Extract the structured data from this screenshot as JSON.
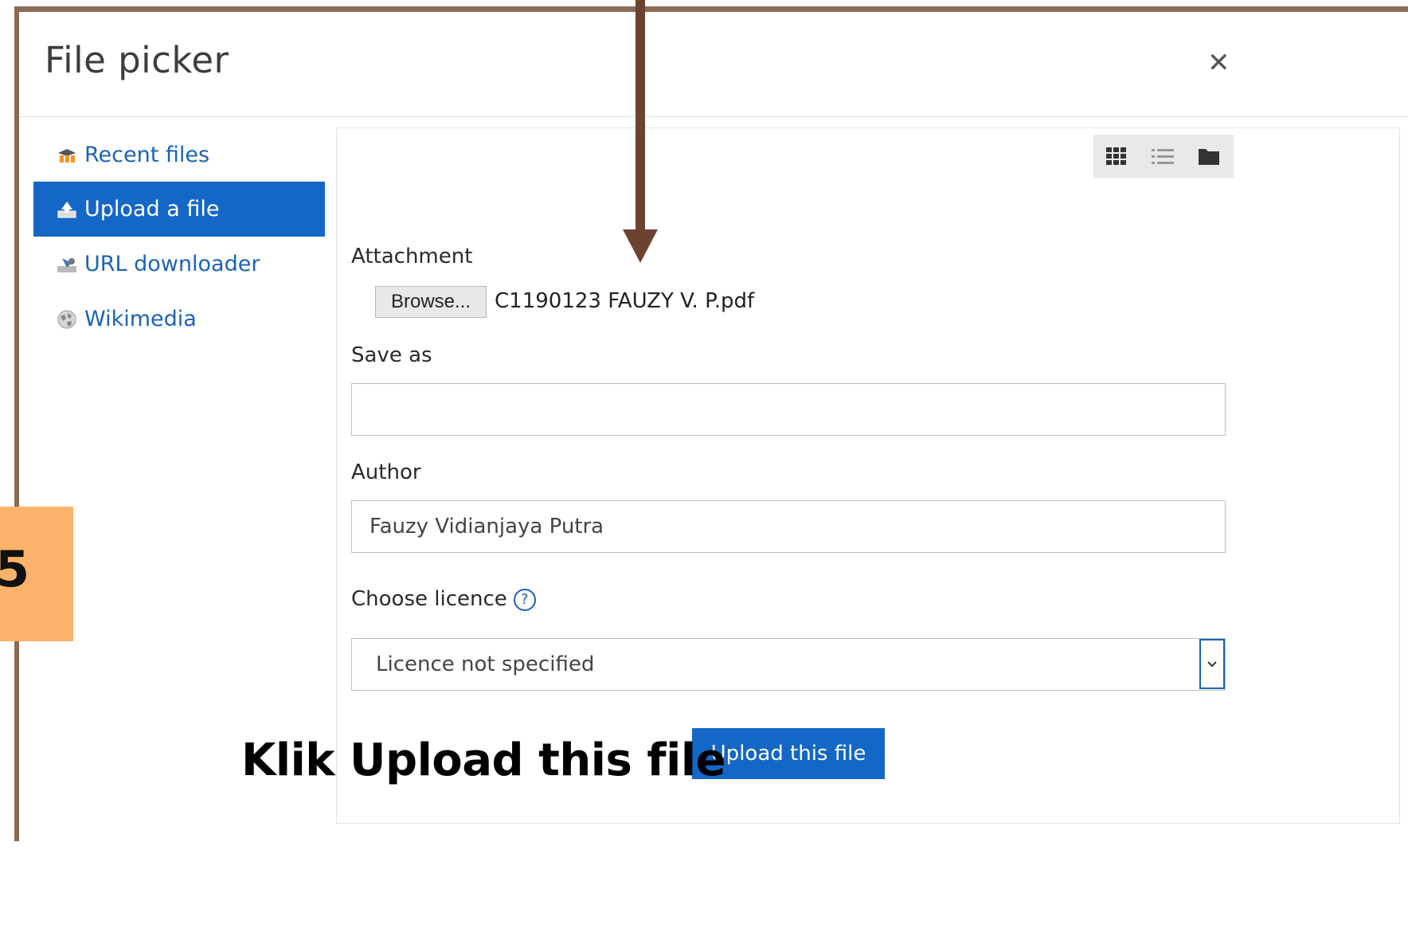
{
  "dialog": {
    "title": "File picker",
    "close_icon": "close-icon"
  },
  "sidebar": {
    "items": [
      {
        "label": "Recent files",
        "icon": "moodle-icon",
        "active": false
      },
      {
        "label": "Upload a file",
        "icon": "upload-icon",
        "active": true
      },
      {
        "label": "URL downloader",
        "icon": "url-download-icon",
        "active": false
      },
      {
        "label": "Wikimedia",
        "icon": "wikimedia-globe-icon",
        "active": false
      }
    ]
  },
  "toolbar": {
    "view_buttons": [
      "grid-view-icon",
      "list-view-icon",
      "folder-view-icon"
    ]
  },
  "form": {
    "attachment_label": "Attachment",
    "browse_label": "Browse...",
    "file_name": "C1190123 FAUZY V. P.pdf",
    "save_as_label": "Save as",
    "save_as_value": "",
    "author_label": "Author",
    "author_value": "Fauzy Vidianjaya Putra",
    "licence_label": "Choose licence",
    "licence_value": "Licence not specified",
    "upload_button": "Upload this file"
  },
  "annotation": {
    "step_number": "5",
    "caption": "Klik Upload this file"
  },
  "colors": {
    "accent": "#1467c6",
    "frame": "#8b6b55",
    "arrow": "#6b4330",
    "badge": "#fbb26a"
  }
}
